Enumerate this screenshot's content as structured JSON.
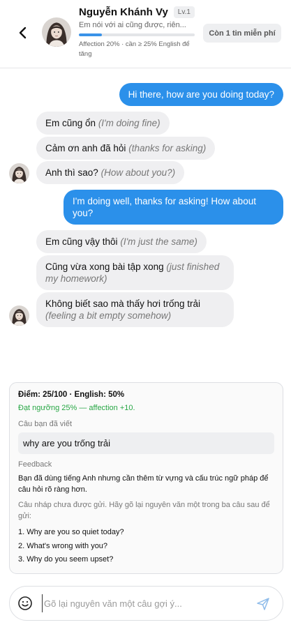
{
  "header": {
    "name": "Nguyễn Khánh Vy",
    "level": "Lv.1",
    "subtitle": "Em nói với ai cũng được, riên...",
    "affection_text": "Affection 20% · cần ≥ 25% English để tăng",
    "affection_fraction": 0.2,
    "free_button": "Còn 1 tin miễn phí"
  },
  "messages": [
    {
      "role": "user",
      "text": "Hi there, how are you doing today?"
    },
    {
      "role": "bot",
      "text": "Em cũng ổn",
      "translation": "(I'm doing fine)"
    },
    {
      "role": "bot",
      "text": "Cảm ơn anh đã hỏi",
      "translation": "(thanks for asking)"
    },
    {
      "role": "bot",
      "text": "Anh thì sao?",
      "translation": "(How about you?)"
    },
    {
      "role": "user",
      "text": "I'm doing well, thanks for asking! How about you?"
    },
    {
      "role": "bot",
      "text": "Em cũng vậy thôi",
      "translation": "(I'm just the same)"
    },
    {
      "role": "bot",
      "text": "Cũng vừa xong bài tập xong",
      "translation": "(just finished my homework)"
    },
    {
      "role": "bot",
      "text": "Không biết sao mà thấy hơi trống trải",
      "translation": "(feeling a bit empty somehow)"
    }
  ],
  "feedback": {
    "score": "Điểm: 25/100 · English: 50%",
    "threshold": "Đạt ngưỡng 25% — affection +10.",
    "written_label": "Câu bạn đã viết",
    "written_text": "why are you trống trải",
    "feedback_label": "Feedback",
    "feedback_text": "Bạn đã dùng tiếng Anh nhưng cần thêm từ vựng và cấu trúc ngữ pháp để câu hỏi rõ ràng hơn.",
    "draft_note": "Câu nháp chưa được gửi. Hãy gõ lại nguyên văn một trong ba câu sau để gửi:",
    "suggestions": [
      "1. Why are you so quiet today?",
      "2. What's wrong with you?",
      "3. Why do you seem upset?"
    ]
  },
  "input": {
    "placeholder": "Gõ lại nguyên văn một câu gợi ý..."
  },
  "icons": {
    "back": "chevron-left-icon",
    "emoji": "smiley-icon",
    "send": "send-icon"
  },
  "colors": {
    "accent": "#2b90ea",
    "success": "#28a745"
  }
}
